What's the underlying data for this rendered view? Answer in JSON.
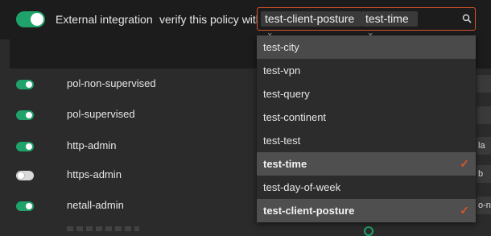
{
  "header": {
    "integration_label": "External integration",
    "verify_label": "verify this policy with",
    "selected_tags": [
      {
        "label": "test-client-posture",
        "remove": "×"
      },
      {
        "label": "test-time",
        "remove": "×"
      }
    ],
    "search_icon": "search-icon"
  },
  "policies": [
    {
      "name": "pol-non-supervised",
      "enabled": true
    },
    {
      "name": "pol-supervised",
      "enabled": true
    },
    {
      "name": "http-admin",
      "enabled": true
    },
    {
      "name": "https-admin",
      "enabled": false
    },
    {
      "name": "netall-admin",
      "enabled": true
    }
  ],
  "right_fragments": [
    "",
    "",
    "la",
    "b",
    "o-ne"
  ],
  "dropdown": {
    "options": [
      {
        "label": "test-city",
        "state": "hover"
      },
      {
        "label": "test-vpn",
        "state": "normal"
      },
      {
        "label": "test-query",
        "state": "normal"
      },
      {
        "label": "test-continent",
        "state": "normal"
      },
      {
        "label": "test-test",
        "state": "normal"
      },
      {
        "label": "test-time",
        "state": "selected",
        "check": "✓"
      },
      {
        "label": "test-day-of-week",
        "state": "normal"
      },
      {
        "label": "test-client-posture",
        "state": "selected",
        "check": "✓"
      }
    ]
  },
  "colors": {
    "accent_green": "#1fa36a",
    "accent_orange": "#d9542b",
    "background": "#2b2b2b"
  }
}
